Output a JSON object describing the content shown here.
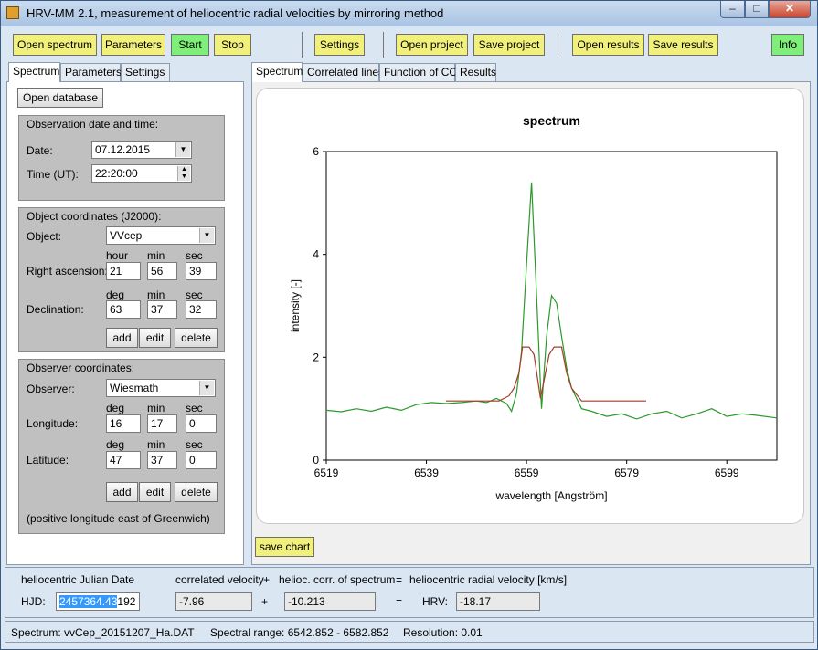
{
  "window": {
    "title": "HRV-MM 2.1,   measurement of heliocentric radial velocities by mirroring method",
    "min_glyph": "–",
    "max_glyph": "□",
    "close_glyph": "✕"
  },
  "toolbar": {
    "open_spectrum": "Open spectrum",
    "parameters": "Parameters",
    "start": "Start",
    "stop": "Stop",
    "settings": "Settings",
    "open_project": "Open project",
    "save_project": "Save project",
    "open_results": "Open results",
    "save_results": "Save results",
    "info": "Info"
  },
  "left_tabs": [
    "Spectrum",
    "Parameters",
    "Settings"
  ],
  "right_tabs": [
    "Spectrum",
    "Correlated lines",
    "Function of CC",
    "Results"
  ],
  "spectrum_tab": {
    "open_database": "Open database",
    "observation": {
      "legend": "Observation date and time:",
      "date_label": "Date:",
      "date_value": "07.12.2015",
      "time_label": "Time (UT):",
      "time_value": "22:20:00"
    },
    "object": {
      "legend": "Object coordinates (J2000):",
      "object_label": "Object:",
      "object_value": "VVcep",
      "ra_label": "Right ascension:",
      "ra_headers": [
        "hour",
        "min",
        "sec"
      ],
      "ra_values": [
        "21",
        "56",
        "39"
      ],
      "dec_label": "Declination:",
      "dec_headers": [
        "deg",
        "min",
        "sec"
      ],
      "dec_values": [
        "63",
        "37",
        "32"
      ],
      "add": "add",
      "edit": "edit",
      "delete": "delete"
    },
    "observer": {
      "legend": "Observer coordinates:",
      "observer_label": "Observer:",
      "observer_value": "Wiesmath",
      "lon_label": "Longitude:",
      "lon_headers": [
        "deg",
        "min",
        "sec"
      ],
      "lon_values": [
        "16",
        "17",
        "0"
      ],
      "lat_label": "Latitude:",
      "lat_headers": [
        "deg",
        "min",
        "sec"
      ],
      "lat_values": [
        "47",
        "37",
        "0"
      ],
      "add": "add",
      "edit": "edit",
      "delete": "delete",
      "note": "(positive longitude east of Greenwich)"
    }
  },
  "save_chart": "save chart",
  "bottom": {
    "hjd_header": "heliocentric Julian Date",
    "corr_header": "correlated velocity",
    "plus1": "+",
    "helio_header": "helioc. corr. of spectrum",
    "equals1": "=",
    "hrv_header": "heliocentric radial velocity [km/s]",
    "hjd_label": "HJD:",
    "hjd_selected": "2457364.43",
    "hjd_rest": "192",
    "corr_value": "-7.96",
    "plus2": "+",
    "helio_value": "-10.213",
    "equals2": "=",
    "hrv_label": "HRV:",
    "hrv_value": "-18.17"
  },
  "status": {
    "spectrum": "Spectrum:  vvCep_20151207_Ha.DAT",
    "range": "Spectral range:  6542.852 - 6582.852",
    "resolution": "Resolution:  0.01"
  },
  "chart_data": {
    "type": "line",
    "title": "spectrum",
    "xlabel": "wavelength [Angström]",
    "ylabel": "intensity [-]",
    "xlim": [
      6519,
      6609
    ],
    "ylim": [
      0,
      6
    ],
    "xticks": [
      6519,
      6539,
      6559,
      6579,
      6599
    ],
    "yticks": [
      0,
      2,
      4,
      6
    ],
    "grid": false,
    "colors": {
      "spectrum": "#2a9a2a",
      "mirrored": "#a83a2a"
    },
    "series": [
      {
        "x": [
          6519,
          6522,
          6525,
          6528,
          6531,
          6534,
          6537,
          6540,
          6543,
          6546,
          6549,
          6551,
          6553,
          6555,
          6556,
          6557,
          6558,
          6559,
          6560,
          6561,
          6562,
          6563,
          6564,
          6565,
          6566,
          6567,
          6568,
          6569,
          6570,
          6572,
          6575,
          6578,
          6581,
          6584,
          6587,
          6590,
          6593,
          6596,
          6599,
          6602,
          6605,
          6609
        ],
        "y": [
          0.97,
          0.94,
          1.0,
          0.95,
          1.03,
          0.97,
          1.08,
          1.12,
          1.1,
          1.12,
          1.15,
          1.12,
          1.2,
          1.1,
          0.95,
          1.3,
          2.1,
          3.8,
          5.4,
          3.2,
          1.0,
          2.4,
          3.2,
          3.05,
          2.4,
          1.8,
          1.4,
          1.2,
          1.0,
          0.95,
          0.85,
          0.9,
          0.8,
          0.9,
          0.95,
          0.82,
          0.9,
          1.0,
          0.85,
          0.9,
          0.87,
          0.82
        ]
      },
      {
        "x": [
          6542.9,
          6553.5,
          6555.5,
          6556.5,
          6557.5,
          6558.2,
          6559.5,
          6560.5,
          6561.8,
          6563.5,
          6564.5,
          6566.0,
          6567.0,
          6568.0,
          6570.0,
          6582.9
        ],
        "y": [
          1.15,
          1.15,
          1.25,
          1.4,
          1.7,
          2.2,
          2.2,
          2.05,
          1.2,
          2.05,
          2.2,
          2.2,
          1.7,
          1.4,
          1.15,
          1.15
        ]
      }
    ]
  }
}
